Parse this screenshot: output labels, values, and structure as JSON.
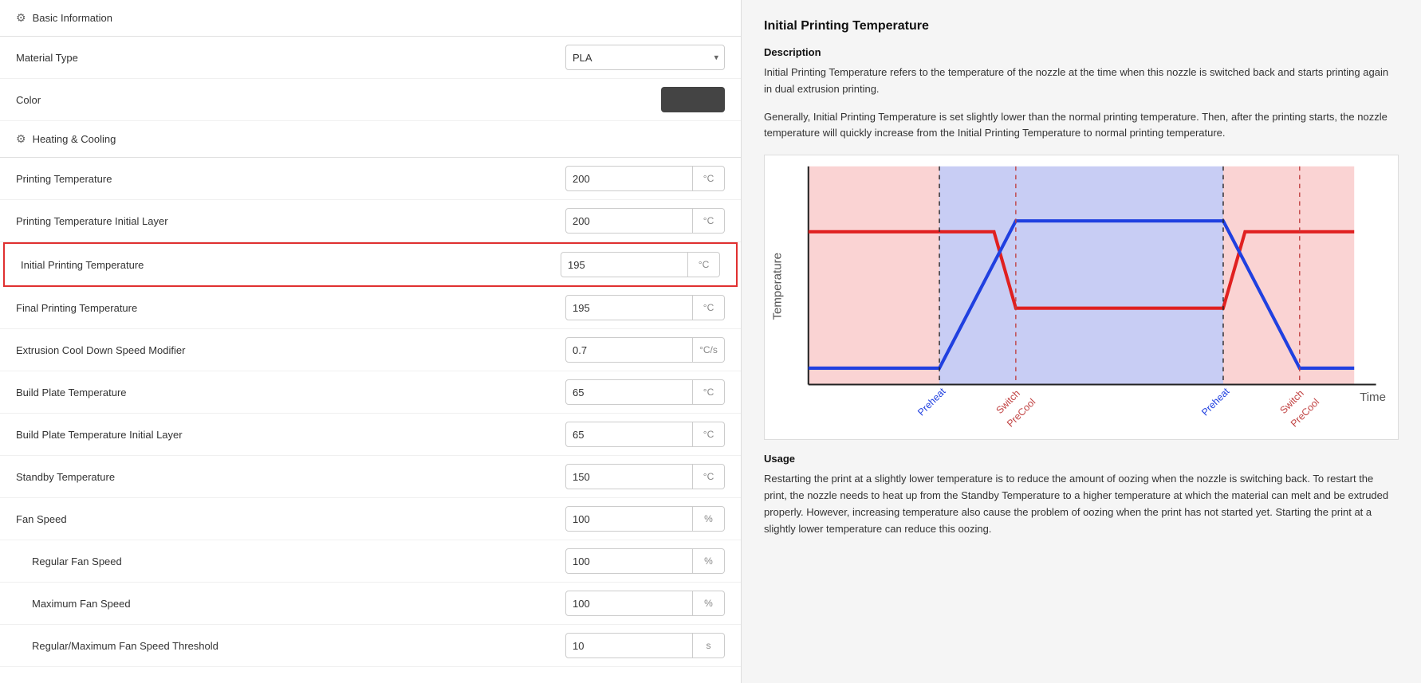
{
  "left": {
    "basic_info_label": "Basic Information",
    "material_type_label": "Material Type",
    "material_type_value": "PLA",
    "color_label": "Color",
    "heating_cooling_label": "Heating & Cooling",
    "settings": [
      {
        "id": "printing-temp",
        "label": "Printing Temperature",
        "value": "200",
        "unit": "°C",
        "indented": false,
        "highlighted": false
      },
      {
        "id": "printing-temp-initial",
        "label": "Printing Temperature Initial Layer",
        "value": "200",
        "unit": "°C",
        "indented": false,
        "highlighted": false
      },
      {
        "id": "initial-printing-temp",
        "label": "Initial Printing Temperature",
        "value": "195",
        "unit": "°C",
        "indented": false,
        "highlighted": true
      },
      {
        "id": "final-printing-temp",
        "label": "Final Printing Temperature",
        "value": "195",
        "unit": "°C",
        "indented": false,
        "highlighted": false
      },
      {
        "id": "extrusion-cool",
        "label": "Extrusion Cool Down Speed Modifier",
        "value": "0.7",
        "unit": "°C/s",
        "indented": false,
        "highlighted": false
      },
      {
        "id": "build-plate-temp",
        "label": "Build Plate Temperature",
        "value": "65",
        "unit": "°C",
        "indented": false,
        "highlighted": false
      },
      {
        "id": "build-plate-initial",
        "label": "Build Plate Temperature Initial Layer",
        "value": "65",
        "unit": "°C",
        "indented": false,
        "highlighted": false
      },
      {
        "id": "standby-temp",
        "label": "Standby Temperature",
        "value": "150",
        "unit": "°C",
        "indented": false,
        "highlighted": false
      },
      {
        "id": "fan-speed",
        "label": "Fan Speed",
        "value": "100",
        "unit": "%",
        "indented": false,
        "highlighted": false
      },
      {
        "id": "regular-fan-speed",
        "label": "Regular Fan Speed",
        "value": "100",
        "unit": "%",
        "indented": true,
        "highlighted": false
      },
      {
        "id": "maximum-fan-speed",
        "label": "Maximum Fan Speed",
        "value": "100",
        "unit": "%",
        "indented": true,
        "highlighted": false
      },
      {
        "id": "fan-speed-threshold",
        "label": "Regular/Maximum Fan Speed Threshold",
        "value": "10",
        "unit": "s",
        "indented": true,
        "highlighted": false
      }
    ]
  },
  "right": {
    "title": "Initial Printing Temperature",
    "description_title": "Description",
    "description_p1": "Initial Printing Temperature refers to the temperature of the nozzle at the time when this nozzle is switched back and starts printing again in dual extrusion printing.",
    "description_p2": "Generally, Initial Printing Temperature is set slightly lower than the normal printing temperature. Then, after the printing starts, the nozzle temperature will quickly increase from the Initial Printing Temperature to normal printing temperature.",
    "usage_title": "Usage",
    "usage_text": "Restarting the print at a slightly lower temperature is to reduce the amount of oozing when the nozzle is switching back. To restart the print, the nozzle needs to heat up from the Standby Temperature to a higher temperature at which the material can melt and be extruded properly. However, increasing temperature also cause the problem of oozing when the print has not started yet. Starting the print at a slightly lower temperature can reduce this oozing.",
    "chart": {
      "y_label": "Temperature",
      "x_label": "Time",
      "labels_bottom": [
        "Preheat",
        "Switch\nPreCool",
        "Preheat",
        "Switch\nPreCool"
      ]
    }
  }
}
